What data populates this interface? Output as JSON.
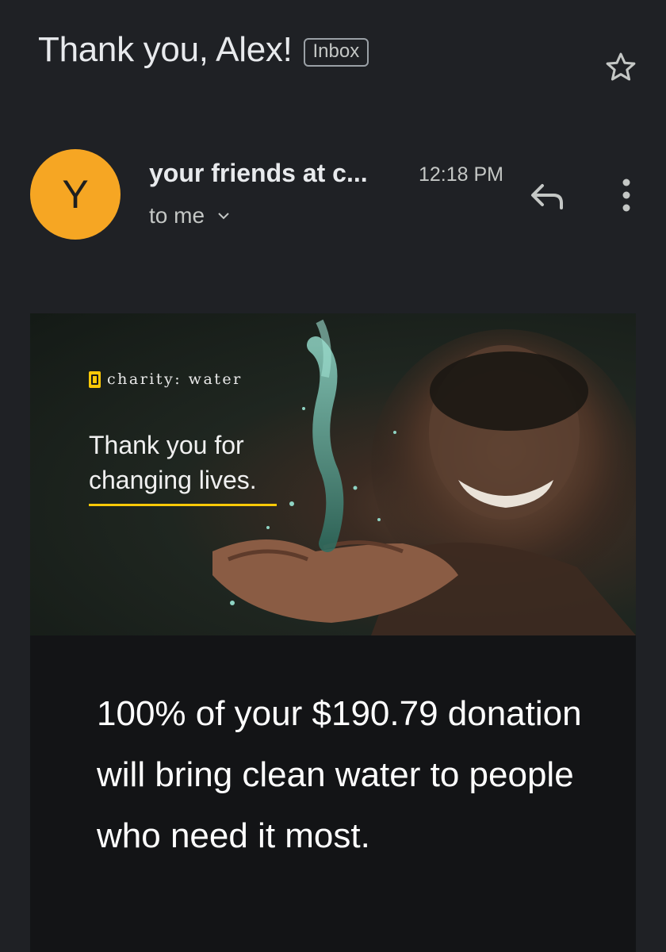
{
  "email": {
    "subject": "Thank you, Alex!",
    "label": "Inbox",
    "sender": "your friends at c...",
    "time": "12:18 PM",
    "recipient": "to me",
    "avatar_letter": "Y",
    "avatar_color": "#f6a623"
  },
  "icons": {
    "star": "star-outline-icon",
    "reply": "reply-icon",
    "more": "more-vertical-icon",
    "expand": "chevron-down-icon"
  },
  "banner": {
    "brand": "charity: water",
    "headline": "Thank you for changing lives.",
    "accent_color": "#ffc907"
  },
  "message": {
    "body": "100% of your $190.79 donation will bring clean water to people who need it most."
  },
  "colors": {
    "background": "#1f2125",
    "card": "#131416"
  }
}
